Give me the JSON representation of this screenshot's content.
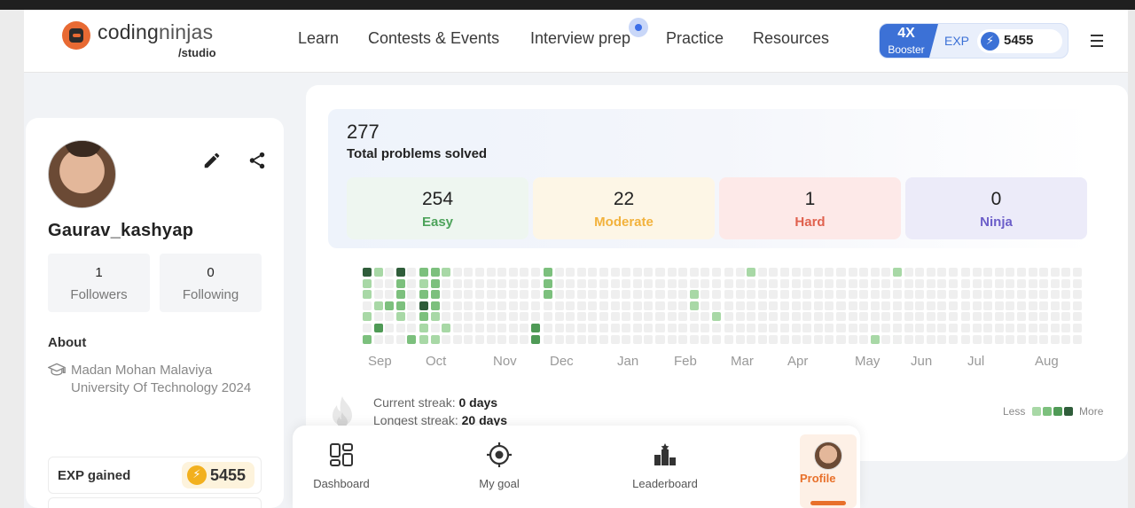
{
  "header": {
    "logo_main": "coding",
    "logo_accent": "ninjas",
    "logo_sub": "/studio",
    "nav": [
      "Learn",
      "Contests & Events",
      "Interview prep",
      "Practice",
      "Resources"
    ],
    "booster_multiplier": "4X",
    "booster_label": "Booster",
    "exp_label": "EXP",
    "exp_value": "5455"
  },
  "profile": {
    "username": "Gaurav_kashyap",
    "followers_count": "1",
    "followers_label": "Followers",
    "following_count": "0",
    "following_label": "Following",
    "about_title": "About",
    "education": "Madan Mohan Malaviya University Of Technology 2024",
    "exp_gained_label": "EXP gained",
    "exp_gained_value": "5455"
  },
  "stats": {
    "total": "277",
    "total_label": "Total problems solved",
    "difficulties": [
      {
        "count": "254",
        "label": "Easy",
        "bg": "#eef6f0",
        "color": "#4da35b"
      },
      {
        "count": "22",
        "label": "Moderate",
        "bg": "#fdf6e6",
        "color": "#f2b23c"
      },
      {
        "count": "1",
        "label": "Hard",
        "bg": "#fde9e8",
        "color": "#e0614e"
      },
      {
        "count": "0",
        "label": "Ninja",
        "bg": "#ecebf9",
        "color": "#6c5ec9"
      }
    ],
    "months": [
      "Sep",
      "Oct",
      "Nov",
      "Dec",
      "Jan",
      "Feb",
      "Mar",
      "Apr",
      "May",
      "Jun",
      "Jul",
      "Aug"
    ],
    "current_streak_label": "Current streak:",
    "current_streak_value": "0 days",
    "longest_streak_label": "Longest streak:",
    "longest_streak_value": "20 days",
    "legend_less": "Less",
    "legend_more": "More",
    "heat_colors": [
      "#efefef",
      "#a8d8a6",
      "#7cc07d",
      "#4f9a56",
      "#2f5d3a"
    ]
  },
  "bottom_nav": {
    "items": [
      "Dashboard",
      "My goal",
      "Leaderboard",
      "Profile"
    ],
    "active": "Profile",
    "accent": "#e8702a"
  }
}
